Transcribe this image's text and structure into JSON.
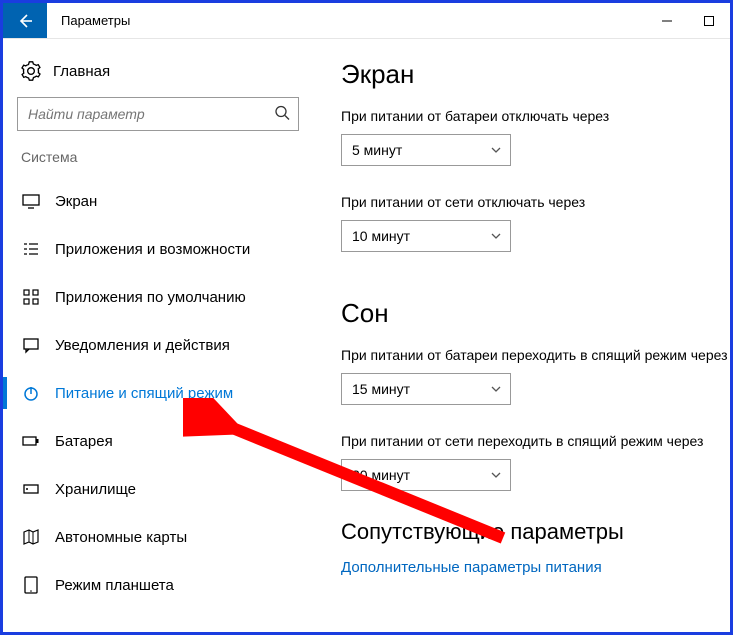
{
  "titlebar": {
    "title": "Параметры"
  },
  "sidebar": {
    "home": "Главная",
    "search_placeholder": "Найти параметр",
    "group": "Система",
    "items": [
      {
        "label": "Экран"
      },
      {
        "label": "Приложения и возможности"
      },
      {
        "label": "Приложения по умолчанию"
      },
      {
        "label": "Уведомления и действия"
      },
      {
        "label": "Питание и спящий режим"
      },
      {
        "label": "Батарея"
      },
      {
        "label": "Хранилище"
      },
      {
        "label": "Автономные карты"
      },
      {
        "label": "Режим планшета"
      }
    ]
  },
  "main": {
    "screen": {
      "heading": "Экран",
      "battery_label": "При питании от батареи отключать через",
      "battery_value": "5 минут",
      "ac_label": "При питании от сети отключать через",
      "ac_value": "10 минут"
    },
    "sleep": {
      "heading": "Сон",
      "battery_label": "При питании от батареи переходить в спящий режим через",
      "battery_value": "15 минут",
      "ac_label": "При питании от сети переходить в спящий режим через",
      "ac_value": "30 минут"
    },
    "related": {
      "heading": "Сопутствующие параметры",
      "link": "Дополнительные параметры питания"
    }
  }
}
